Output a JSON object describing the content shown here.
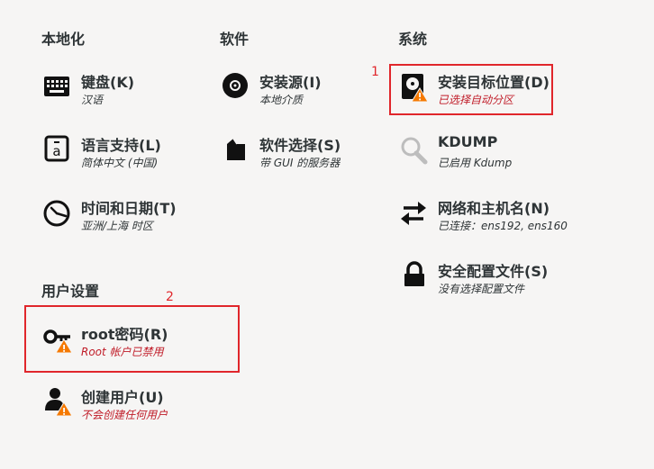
{
  "categories": {
    "localization": "本地化",
    "software": "软件",
    "system": "系统",
    "user_settings": "用户设置"
  },
  "spokes": {
    "keyboard": {
      "title": "键盘(K)",
      "status": "汉语",
      "icon": "keyboard-icon"
    },
    "language": {
      "title": "语言支持(L)",
      "status": "简体中文 (中国)",
      "icon": "language-icon"
    },
    "datetime": {
      "title": "时间和日期(T)",
      "status": "亚洲/上海 时区",
      "icon": "clock-icon"
    },
    "source": {
      "title": "安装源(I)",
      "status": "本地介质",
      "icon": "disc-icon"
    },
    "software": {
      "title": "软件选择(S)",
      "status": "带 GUI 的服务器",
      "icon": "package-icon"
    },
    "destination": {
      "title": "安装目标位置(D)",
      "status": "已选择自动分区",
      "icon": "disk-warning-icon"
    },
    "kdump": {
      "title": "KDUMP",
      "status": "已启用 Kdump",
      "icon": "magnifier-icon"
    },
    "network": {
      "title": "网络和主机名(N)",
      "status": "已连接：ens192, ens160",
      "icon": "network-arrows-icon"
    },
    "security": {
      "title": "安全配置文件(S)",
      "status": "没有选择配置文件",
      "icon": "lock-icon"
    },
    "root": {
      "title": "root密码(R)",
      "status": "Root 帐户已禁用",
      "icon": "key-warning-icon"
    },
    "user": {
      "title": "创建用户(U)",
      "status": "不会创建任何用户",
      "icon": "user-warning-icon"
    }
  },
  "annotations": {
    "one": "1",
    "two": "2"
  },
  "colors": {
    "warning_text": "#c01c28",
    "highlight": "#e0262b",
    "warning_triangle": "#f57900",
    "background": "#f6f5f4"
  }
}
